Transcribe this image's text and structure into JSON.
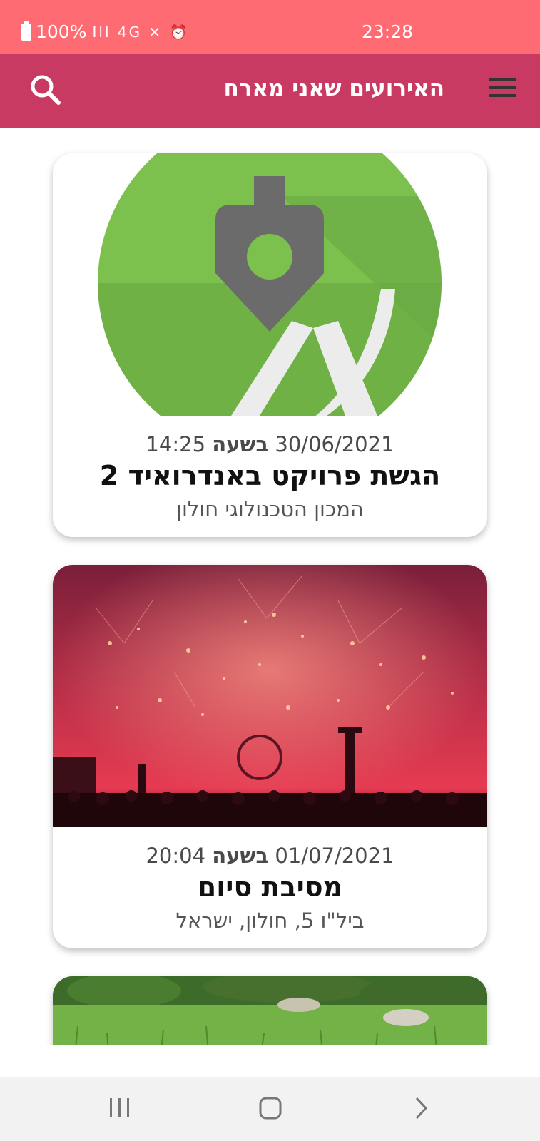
{
  "status_bar": {
    "battery": "100%",
    "signal_glyphs": "Ill 4G ✕ ⏰",
    "time": "23:28"
  },
  "app_bar": {
    "title": "האירועים שאני מארח",
    "menu_icon": "hamburger-menu-icon",
    "search_icon": "search-icon"
  },
  "events": [
    {
      "date": "30/06/2021",
      "at": "בשעה",
      "time": "14:25",
      "title": "הגשת פרויקט באנדרואיד 2",
      "location": "המכון הטכנולוגי חולון",
      "image": "android-studio-logo"
    },
    {
      "date": "01/07/2021",
      "at": "בשעה",
      "time": "20:04",
      "title": "מסיבת סיום",
      "location": "ביל\"ו 5, חולון, ישראל",
      "image": "fireworks-photo"
    },
    {
      "image": "grass-field-photo"
    }
  ],
  "nav_bar": {
    "recents": "recents-icon",
    "home": "home-icon",
    "back": "back-icon"
  },
  "colors": {
    "status_bar": "#ff6b72",
    "app_bar": "#c93a63",
    "android_green": "#7cc14e"
  }
}
